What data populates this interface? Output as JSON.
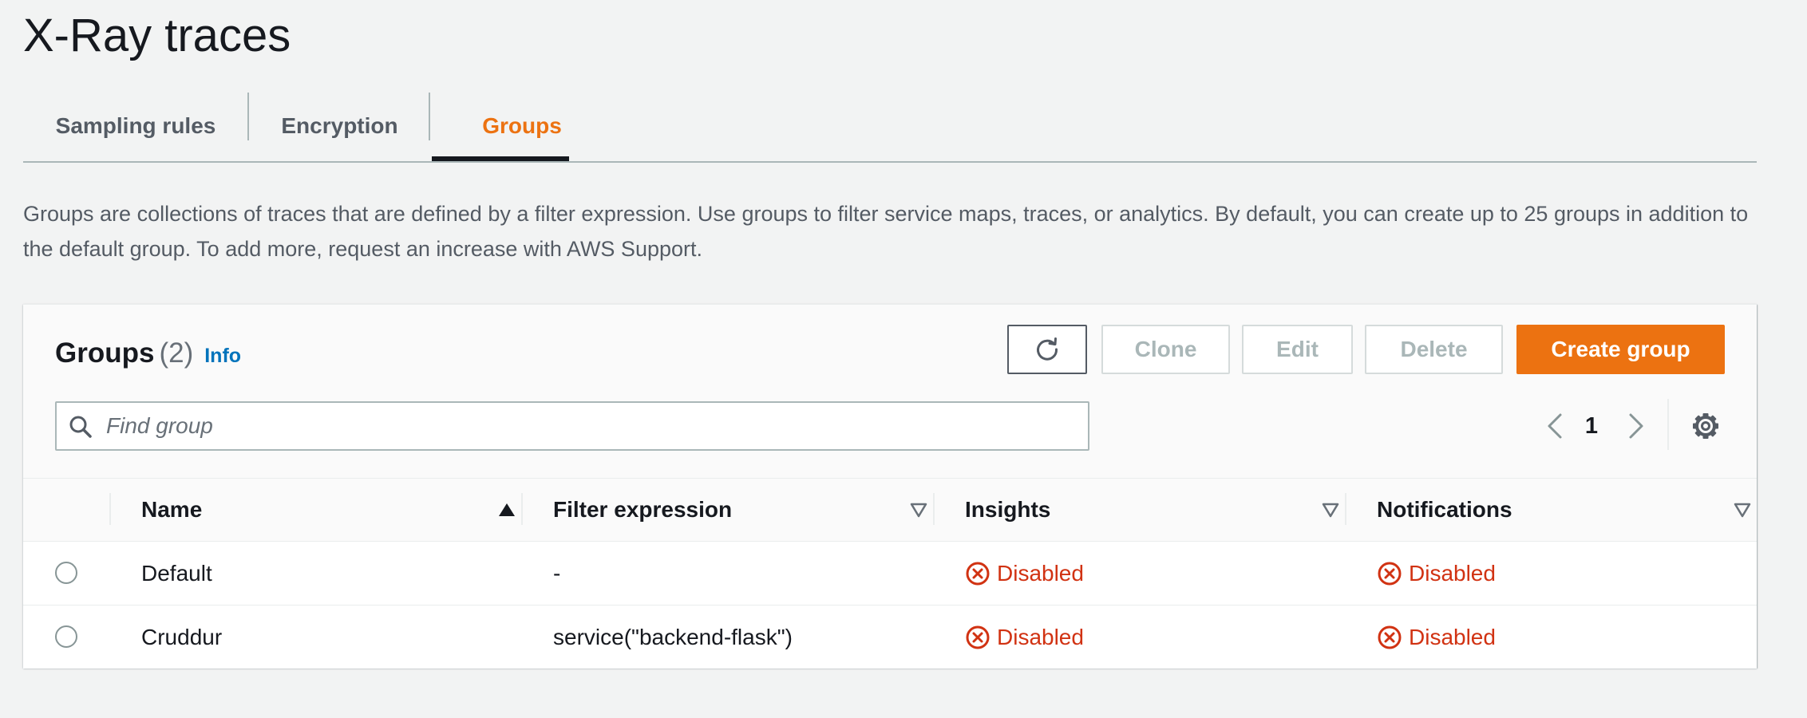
{
  "page": {
    "title": "X-Ray traces"
  },
  "tabs": [
    {
      "label": "Sampling rules",
      "active": false
    },
    {
      "label": "Encryption",
      "active": false
    },
    {
      "label": "Groups",
      "active": true
    }
  ],
  "description": "Groups are collections of traces that are defined by a filter expression. Use groups to filter service maps, traces, or analytics. By default, you can create up to 25 groups in addition to the default group. To add more, request an increase with AWS Support.",
  "groups_panel": {
    "title": "Groups",
    "count": "(2)",
    "info_link": "Info",
    "actions": {
      "refresh_icon": "refresh-icon",
      "clone": "Clone",
      "edit": "Edit",
      "delete": "Delete",
      "create": "Create group"
    },
    "search": {
      "placeholder": "Find group",
      "value": ""
    },
    "pagination": {
      "current_page": "1"
    }
  },
  "table": {
    "columns": [
      {
        "label": "Name",
        "sort": "ascending"
      },
      {
        "label": "Filter expression",
        "sort": "none"
      },
      {
        "label": "Insights",
        "sort": "none"
      },
      {
        "label": "Notifications",
        "sort": "none"
      }
    ],
    "rows": [
      {
        "name": "Default",
        "filter": "-",
        "insights": "Disabled",
        "notifications": "Disabled"
      },
      {
        "name": "Cruddur",
        "filter": "service(\"backend-flask\")",
        "insights": "Disabled",
        "notifications": "Disabled"
      }
    ]
  },
  "colors": {
    "accent": "#ec7211",
    "link": "#0073bb",
    "error": "#d13212",
    "text": "#16191f",
    "secondary_text": "#545b64"
  }
}
